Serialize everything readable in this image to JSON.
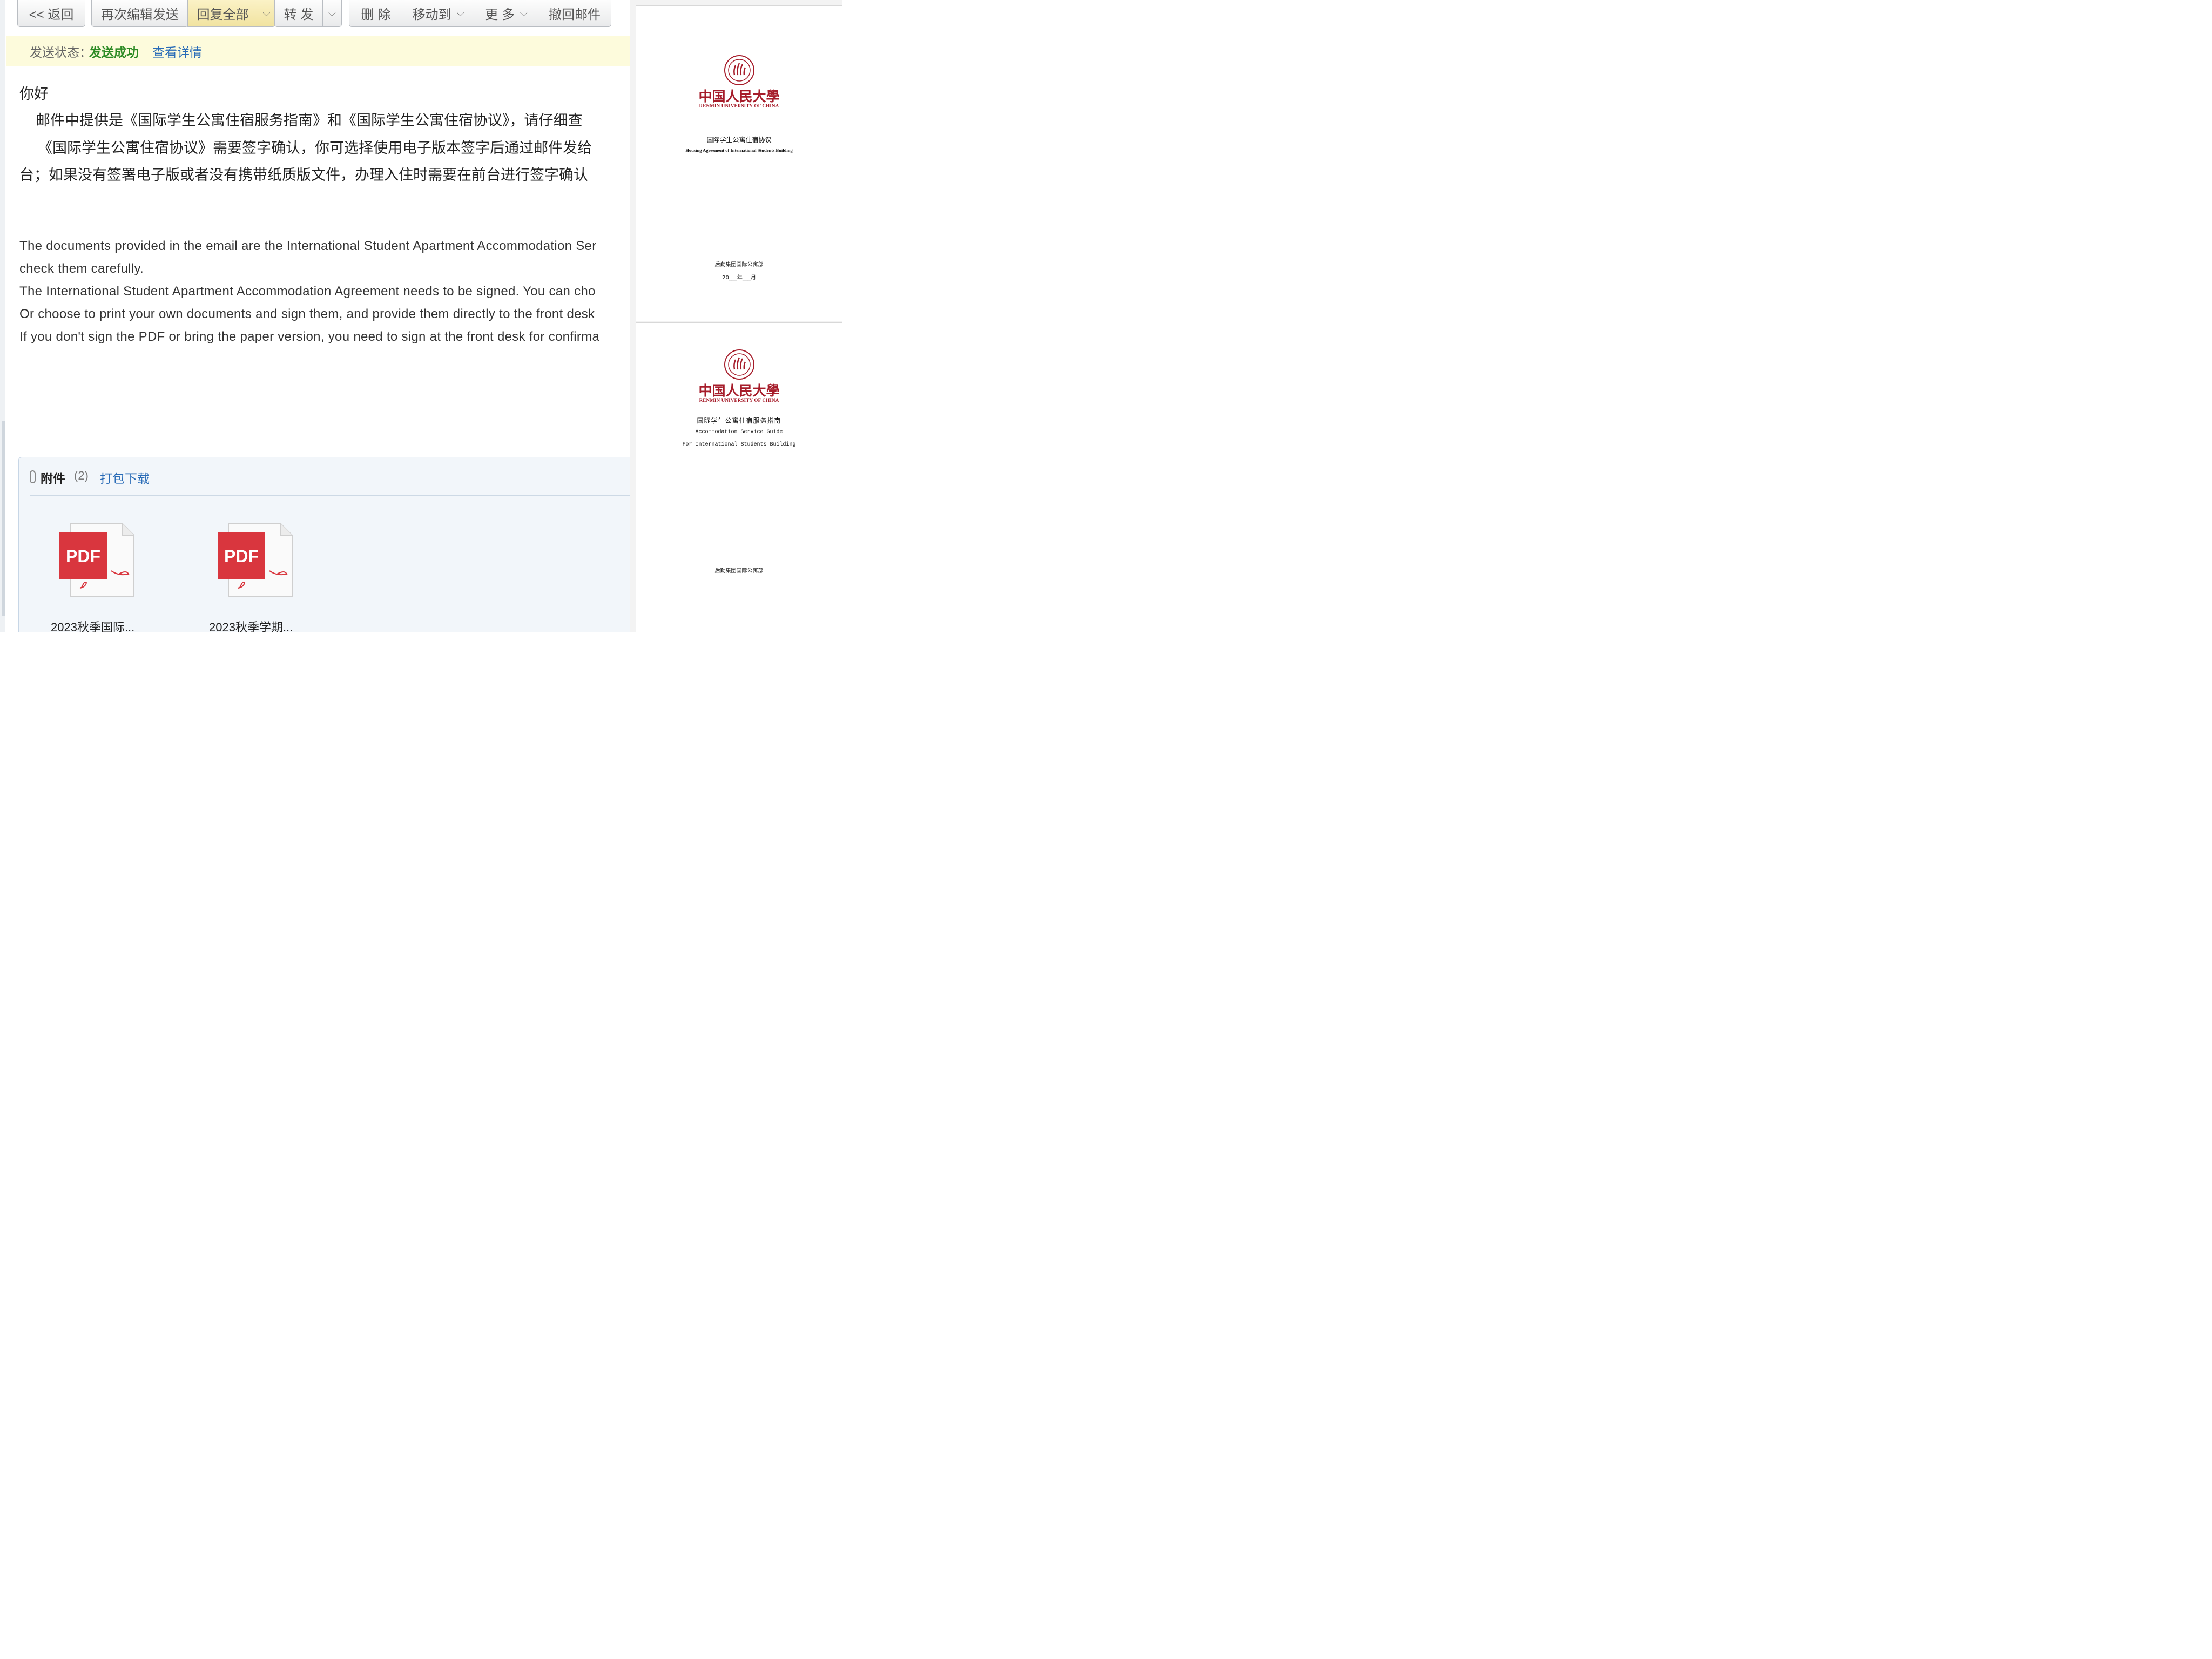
{
  "toolbar": {
    "back": "<< 返回",
    "reedit": "再次编辑发送",
    "reply_all": "回复全部",
    "forward": "转 发",
    "delete": "删 除",
    "move_to": "移动到",
    "more": "更 多",
    "recall": "撤回邮件"
  },
  "status": {
    "label": "发送状态：",
    "value": "发送成功",
    "details_link": "查看详情"
  },
  "body": {
    "greeting": "你好",
    "zh_lines": [
      "邮件中提供是《国际学生公寓住宿服务指南》和《国际学生公寓住宿协议》，请仔细查",
      "《国际学生公寓住宿协议》需要签字确认，你可选择使用电子版本签字后通过邮件发给",
      "台；如果没有签署电子版或者没有携带纸质版文件，办理入住时需要在前台进行签字确认"
    ],
    "en_lines": [
      "The documents provided in the email are the International Student Apartment Accommodation Ser",
      "check them carefully.",
      "The International Student Apartment Accommodation Agreement needs to be signed. You can cho",
      "Or choose to print your own documents and sign them, and provide them directly to the front desk",
      "If you don't sign the PDF or bring the paper version, you need to sign at the front desk for confirma"
    ]
  },
  "attachments": {
    "title": "附件",
    "count": "(2)",
    "download_all": "打包下载",
    "files": [
      {
        "icon_label": "PDF",
        "name": "2023秋季国际..."
      },
      {
        "icon_label": "PDF",
        "name": "2023秋季学期..."
      }
    ]
  },
  "documents": [
    {
      "university_zh": "中国人民大學",
      "university_en": "RENMIN UNIVERSITY OF CHINA",
      "title_zh": "国际学生公寓住宿协议",
      "title_en": "Housing Agreement of International Students Building",
      "department": "后勤集团国际公寓部",
      "date": "20___年___月"
    },
    {
      "university_zh": "中国人民大學",
      "university_en": "RENMIN UNIVERSITY OF CHINA",
      "title_zh": "国际学生公寓住宿服务指南",
      "title_en_1": "Accommodation Service Guide",
      "title_en_2": "For International Students Building",
      "department": "后勤集团国际公寓部"
    }
  ],
  "colors": {
    "success": "#2c8a24",
    "link": "#2a6cb7",
    "brand_red": "#a61c2a",
    "pdf_red": "#d9363e",
    "status_bg": "#fdfbdc"
  }
}
